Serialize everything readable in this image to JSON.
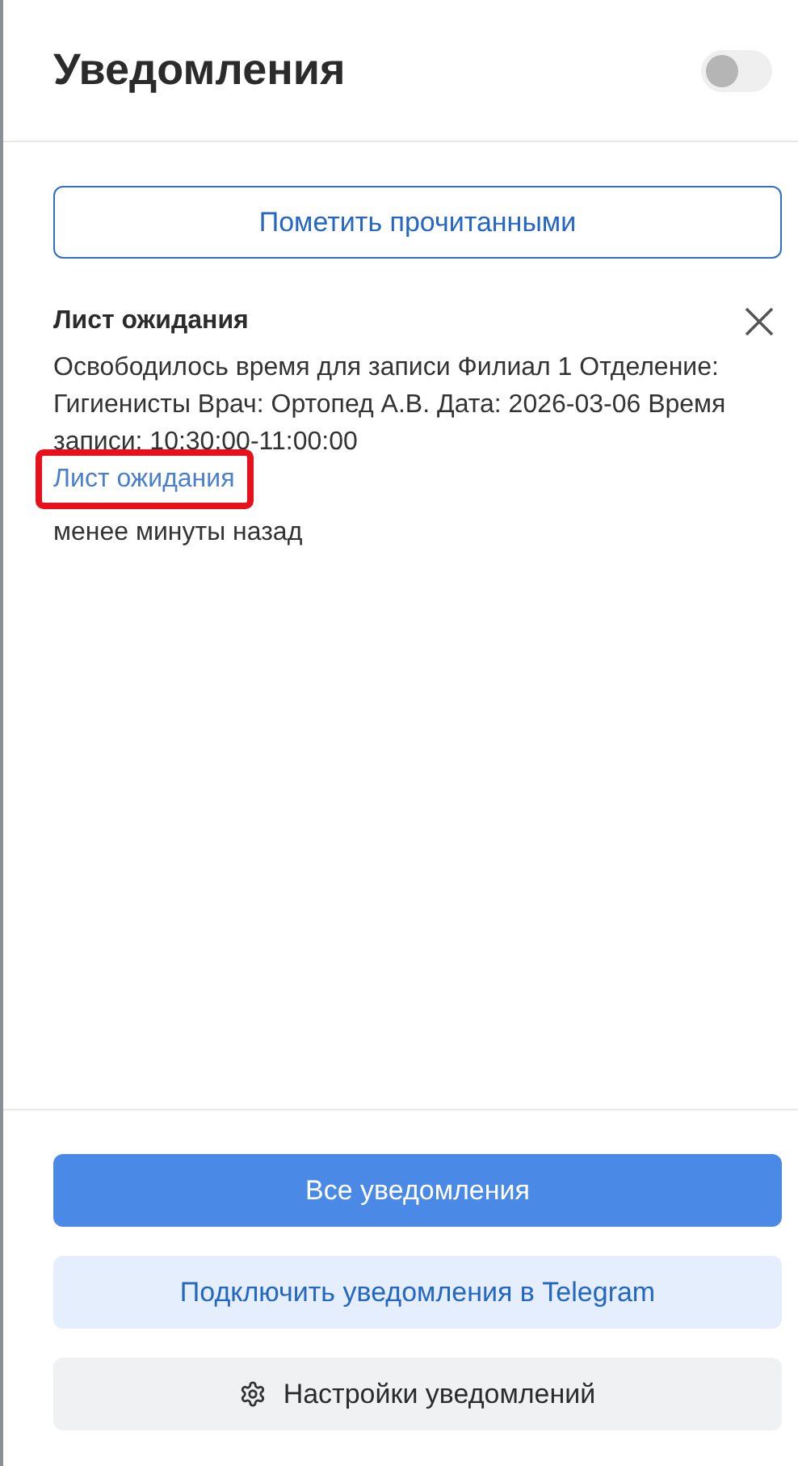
{
  "header": {
    "title": "Уведомления",
    "toggle": {
      "on": false
    }
  },
  "mark_read_button": "Пометить прочитанными",
  "notifications": [
    {
      "title": "Лист ожидания",
      "text": "Освободилось время для записи Филиал 1 Отделение: Гигиенисты Врач: Ортопед А.В. Дата: 2026-03-06 Время записи: 10:30:00-11:00:00",
      "link": {
        "label": "Лист ожидания",
        "highlighted": true
      },
      "time": "менее минуты назад"
    }
  ],
  "footer_buttons": [
    {
      "kind": "primary",
      "label": "Все уведомления"
    },
    {
      "kind": "secondary",
      "label": "Подключить уведомления в Telegram"
    },
    {
      "kind": "settings",
      "label": "Настройки уведомлений"
    }
  ]
}
